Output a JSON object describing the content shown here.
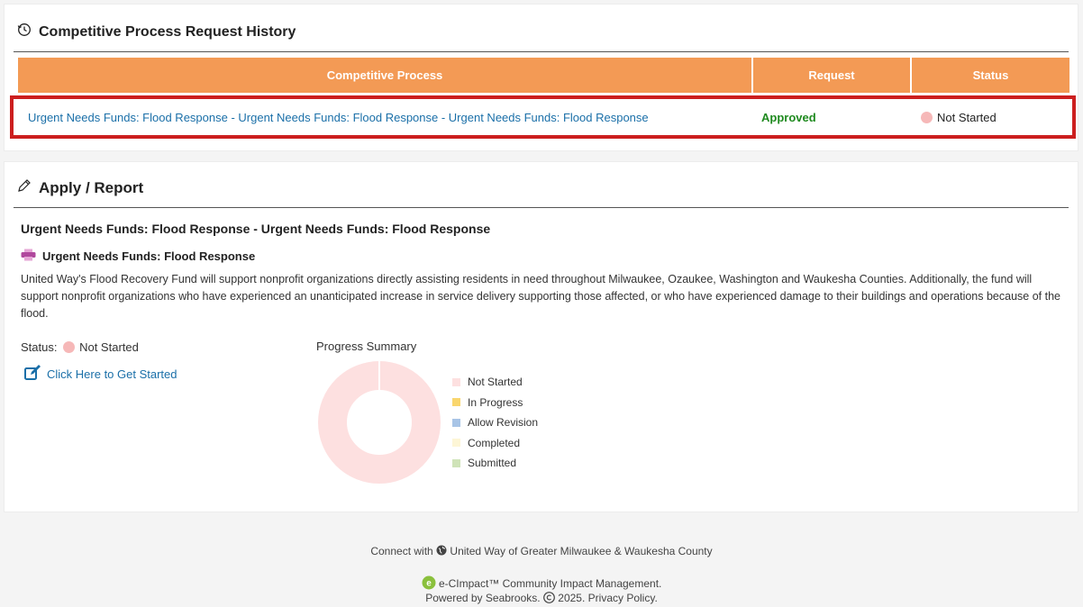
{
  "history": {
    "title": "Competitive Process Request History",
    "columns": [
      "Competitive Process",
      "Request",
      "Status"
    ],
    "row": {
      "process": "Urgent Needs Funds: Flood Response - Urgent Needs Funds: Flood Response - Urgent Needs Funds: Flood Response",
      "request": "Approved",
      "status": "Not Started"
    }
  },
  "apply": {
    "title": "Apply / Report",
    "program_title": "Urgent Needs Funds: Flood Response - Urgent Needs Funds: Flood Response",
    "fund_name": "Urgent Needs Funds: Flood Response",
    "description": "United Way's Flood Recovery Fund will support nonprofit organizations directly assisting residents in need throughout Milwaukee, Ozaukee, Washington and Waukesha Counties. Additionally, the fund will support nonprofit organizations who have experienced an unanticipated increase in service delivery supporting those affected, or who have experienced damage to their buildings and operations because of the flood.",
    "status_label": "Status:",
    "status_value": "Not Started",
    "get_started": "Click Here to Get Started",
    "progress_title": "Progress Summary"
  },
  "chart_data": {
    "type": "pie",
    "title": "Progress Summary",
    "categories": [
      "Not Started",
      "In Progress",
      "Allow Revision",
      "Completed",
      "Submitted"
    ],
    "values": [
      1,
      0,
      0,
      0,
      0
    ],
    "colors": [
      "#fde0e0",
      "#f9d66e",
      "#a8c4e6",
      "#fdf6d6",
      "#cfe3b8"
    ],
    "legend_position": "right"
  },
  "footer": {
    "connect_prefix": "Connect with",
    "org_name": "United Way of Greater Milwaukee & Waukesha County",
    "product": "e-CImpact™ Community Impact Management.",
    "powered": "Powered by Seabrooks.",
    "year": "2025.",
    "privacy": "Privacy Policy."
  },
  "colors": {
    "header_orange": "#f39a55",
    "link_blue": "#1a6fa8",
    "approved_green": "#1f8a1f",
    "highlight_red": "#cc1f1f"
  }
}
